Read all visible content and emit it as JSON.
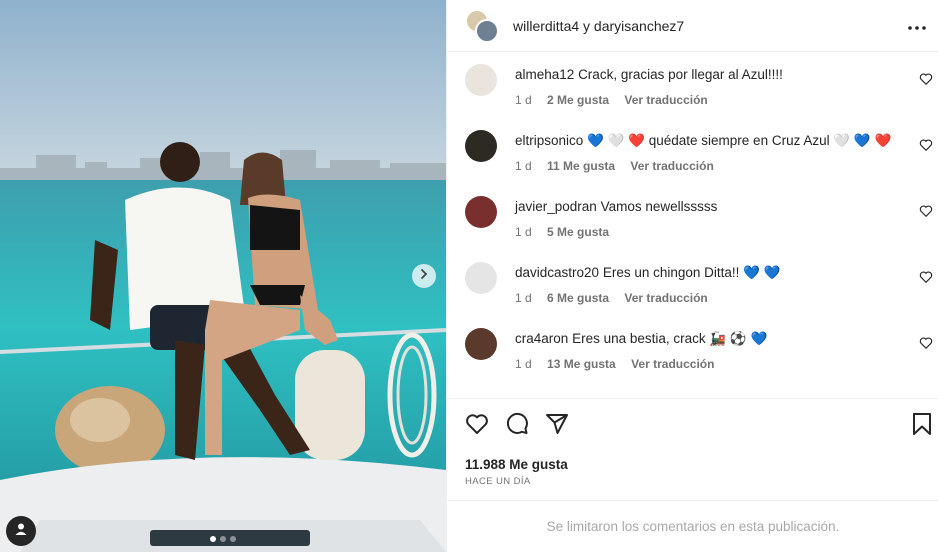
{
  "post": {
    "header_title": "willerditta4 y daryisanchez7",
    "likes": "11.988 Me gusta",
    "time_ago": "HACE UN DÍA",
    "comments_limited": "Se limitaron los comentarios en esta publicación.",
    "carousel": {
      "slides": 3,
      "active": 1
    }
  },
  "icons": {
    "more": "more-horizontal-icon",
    "like": "heart-icon",
    "comment": "comment-bubble-icon",
    "share": "paper-plane-icon",
    "save": "bookmark-icon",
    "next": "chevron-right-icon",
    "tag": "user-tag-icon"
  },
  "comments": [
    {
      "user": "almeha12",
      "text": "Crack, gracias por llegar al Azul!!!!",
      "time": "1 d",
      "likes": "2 Me gusta",
      "translate": "Ver traducción",
      "avatar_color": "#e9e4de"
    },
    {
      "user": "eltripsonico",
      "text_before": "💙 🤍 ❤️  quédate siempre en Cruz Azul 🤍 💙 ❤️",
      "time": "1 d",
      "likes": "11 Me gusta",
      "translate": "Ver traducción",
      "avatar_color": "#2c2a22"
    },
    {
      "user": "javier_podran",
      "text": "Vamos newellsssss",
      "time": "1 d",
      "likes": "5 Me gusta",
      "translate": "",
      "avatar_color": "#7a2f2f"
    },
    {
      "user": "davidcastro20",
      "text": "Eres un chingon Ditta!! 💙 💙",
      "time": "1 d",
      "likes": "6 Me gusta",
      "translate": "Ver traducción",
      "avatar_color": "#e5e5e5"
    },
    {
      "user": "cra4aron",
      "text": "Eres una bestia, crack 🚂 ⚽ 💙",
      "time": "1 d",
      "likes": "13 Me gusta",
      "translate": "Ver traducción",
      "avatar_color": "#5a3a2a"
    }
  ],
  "colors": {
    "text": "#262626",
    "secondary": "#737373",
    "muted": "#a8a8a8",
    "border": "#efefef",
    "sea": "#2fb3b8",
    "sky": "#a9c6d8"
  }
}
